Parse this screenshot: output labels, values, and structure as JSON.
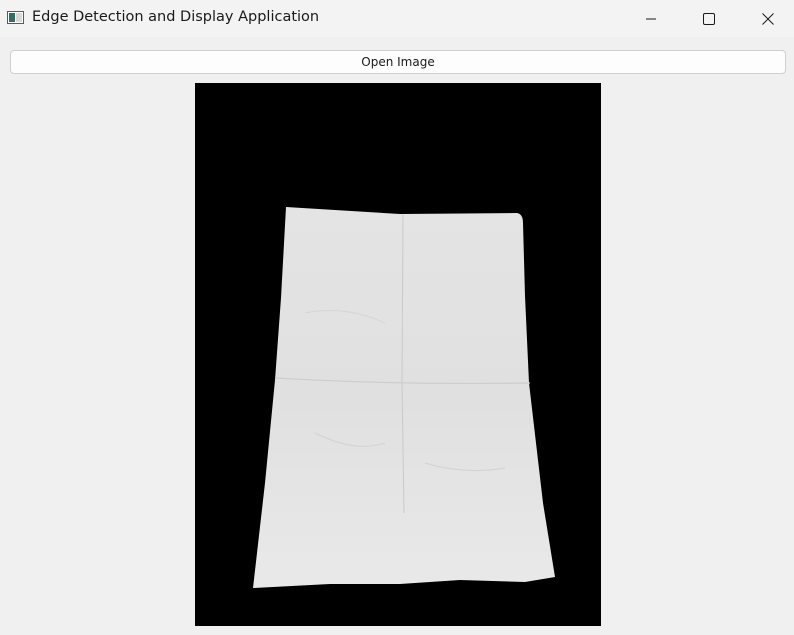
{
  "window": {
    "title": "Edge Detection and Display Application",
    "icon": "app-window-icon"
  },
  "caption_buttons": {
    "minimize_icon": "minimize-icon",
    "maximize_icon": "maximize-icon",
    "close_icon": "close-icon"
  },
  "toolbar": {
    "open_label": "Open Image"
  },
  "image_display": {
    "content": "photo of a folded white sheet of paper on a black background"
  },
  "colors": {
    "window_bg": "#f0f0f0",
    "image_bg": "#000000",
    "paper": "#e2e2e2"
  }
}
